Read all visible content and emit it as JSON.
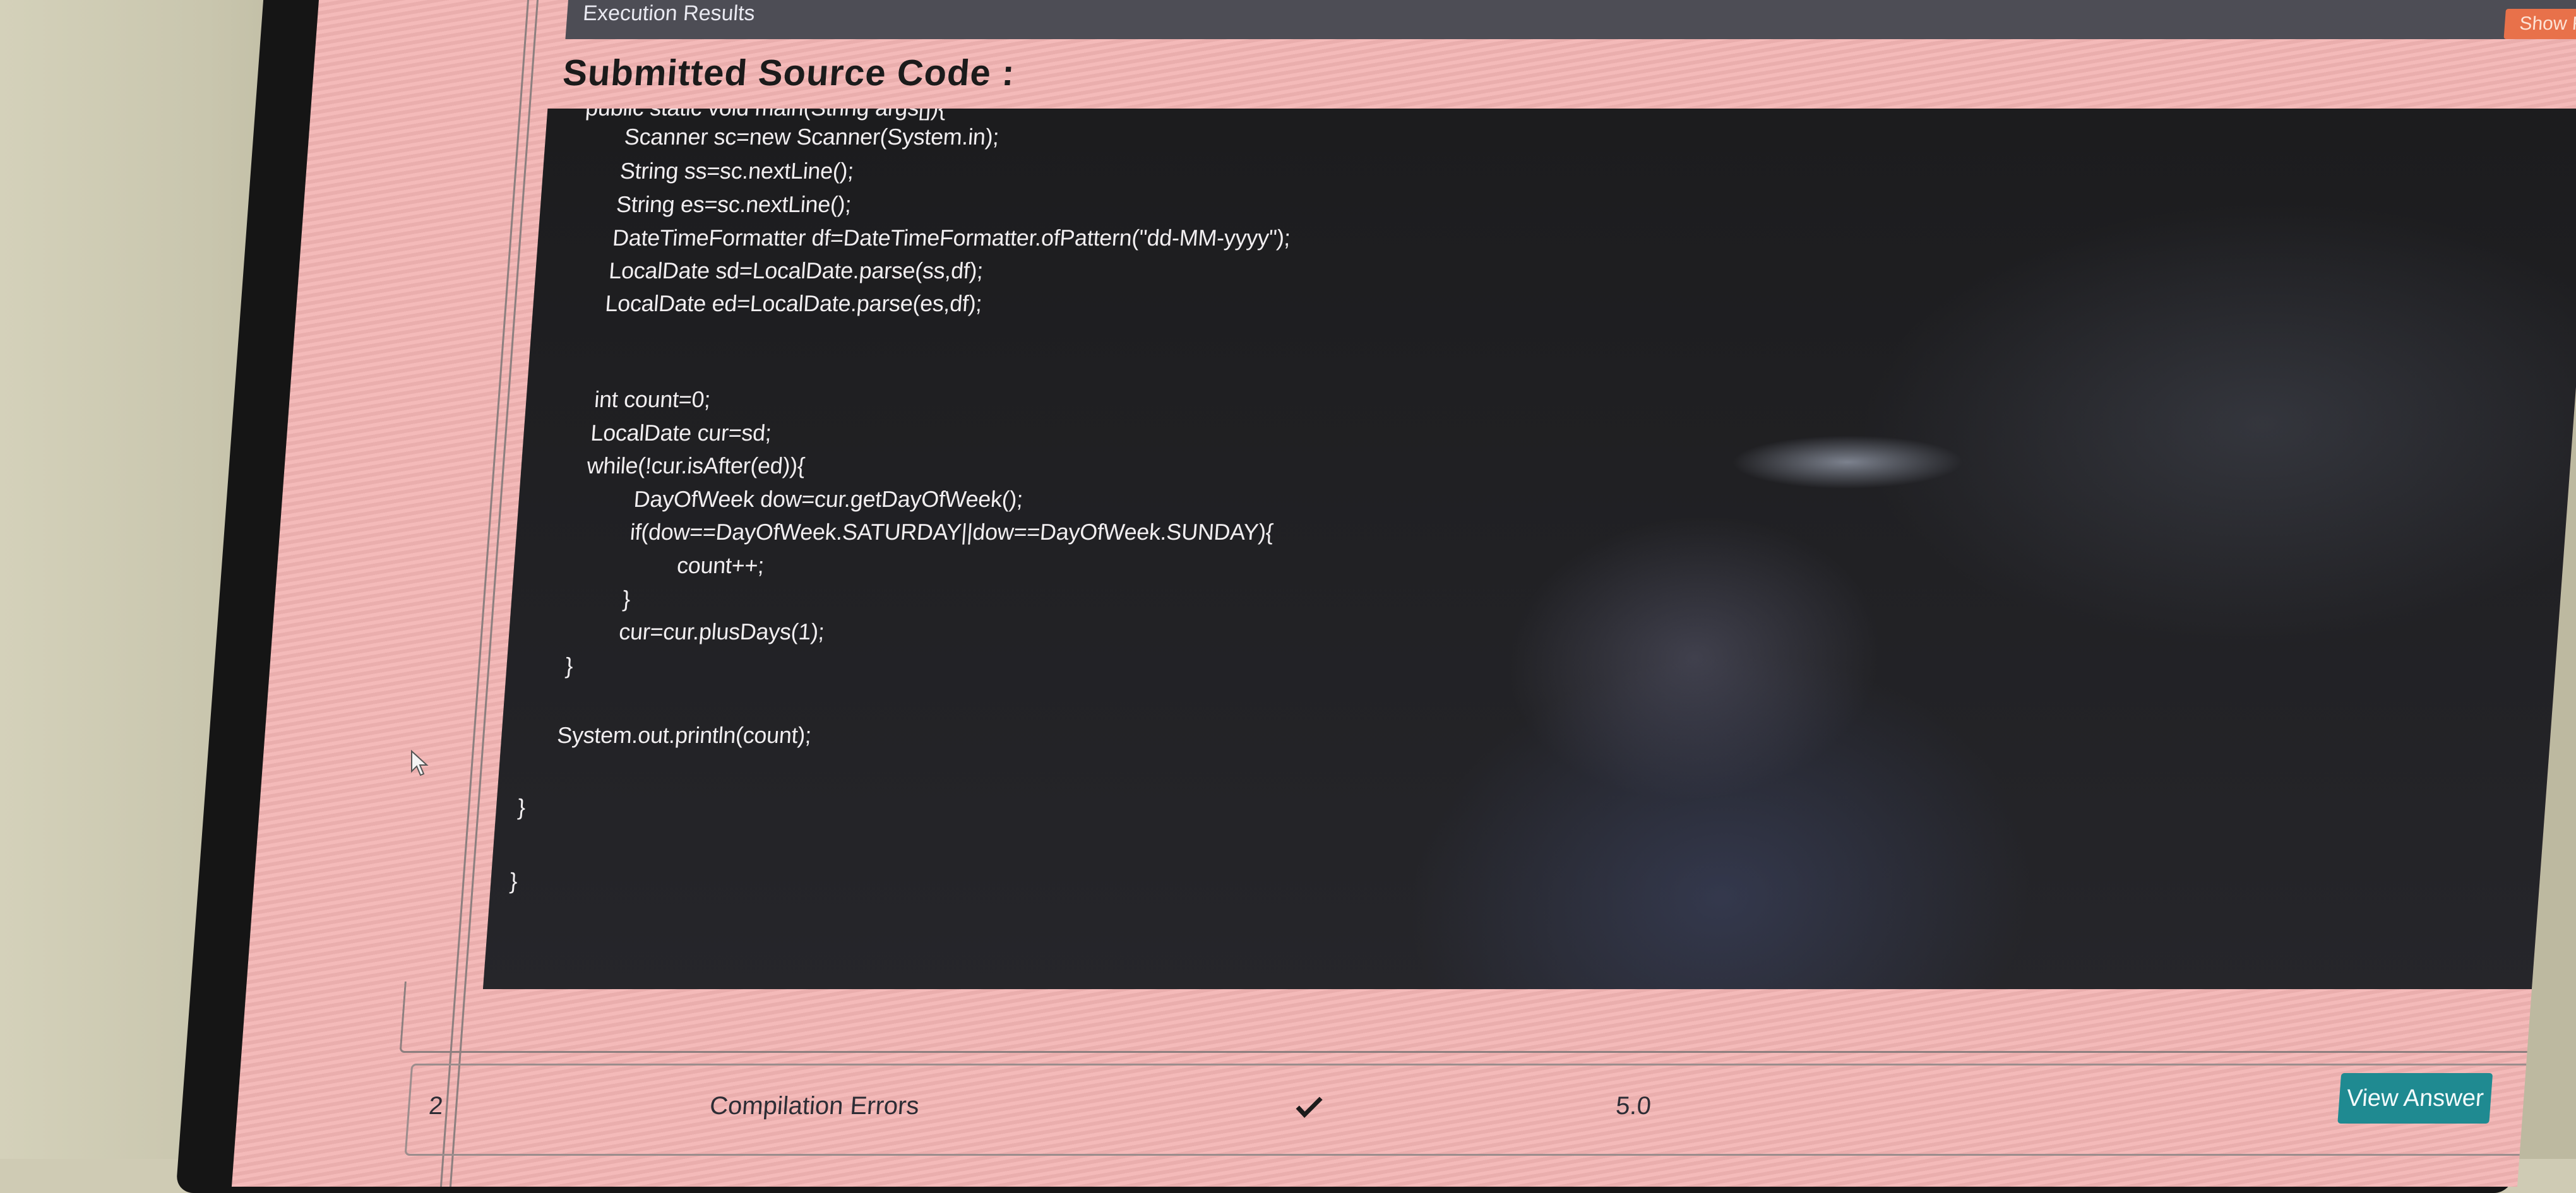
{
  "header": {
    "section_label": "Execution Results",
    "show_results_label": "Show Results"
  },
  "source": {
    "heading": "Submitted Source Code :",
    "lines": [
      "public static void main(String args[]){",
      "Scanner sc=new Scanner(System.in);",
      "String ss=sc.nextLine();",
      "String es=sc.nextLine();",
      "DateTimeFormatter df=DateTimeFormatter.ofPattern(\"dd-MM-yyyy\");",
      "LocalDate sd=LocalDate.parse(ss,df);",
      "LocalDate ed=LocalDate.parse(es,df);",
      "int count=0;",
      "LocalDate cur=sd;",
      "while(!cur.isAfter(ed)){",
      "DayOfWeek dow=cur.getDayOfWeek();",
      "if(dow==DayOfWeek.SATURDAY||dow==DayOfWeek.SUNDAY){",
      "count++;",
      "}",
      "cur=cur.plusDays(1);",
      "}",
      "System.out.println(count);",
      "}",
      "}"
    ]
  },
  "result_row": {
    "index": "2",
    "status": "Compilation Errors",
    "check_icon": "check-icon",
    "score": "5.0",
    "view_answer_label": "View Answer"
  },
  "colors": {
    "page_bg": "#f3b5b4",
    "code_bg": "#1c1c1e",
    "button_teal": "#1f8a91",
    "button_orange": "#e8714a"
  }
}
